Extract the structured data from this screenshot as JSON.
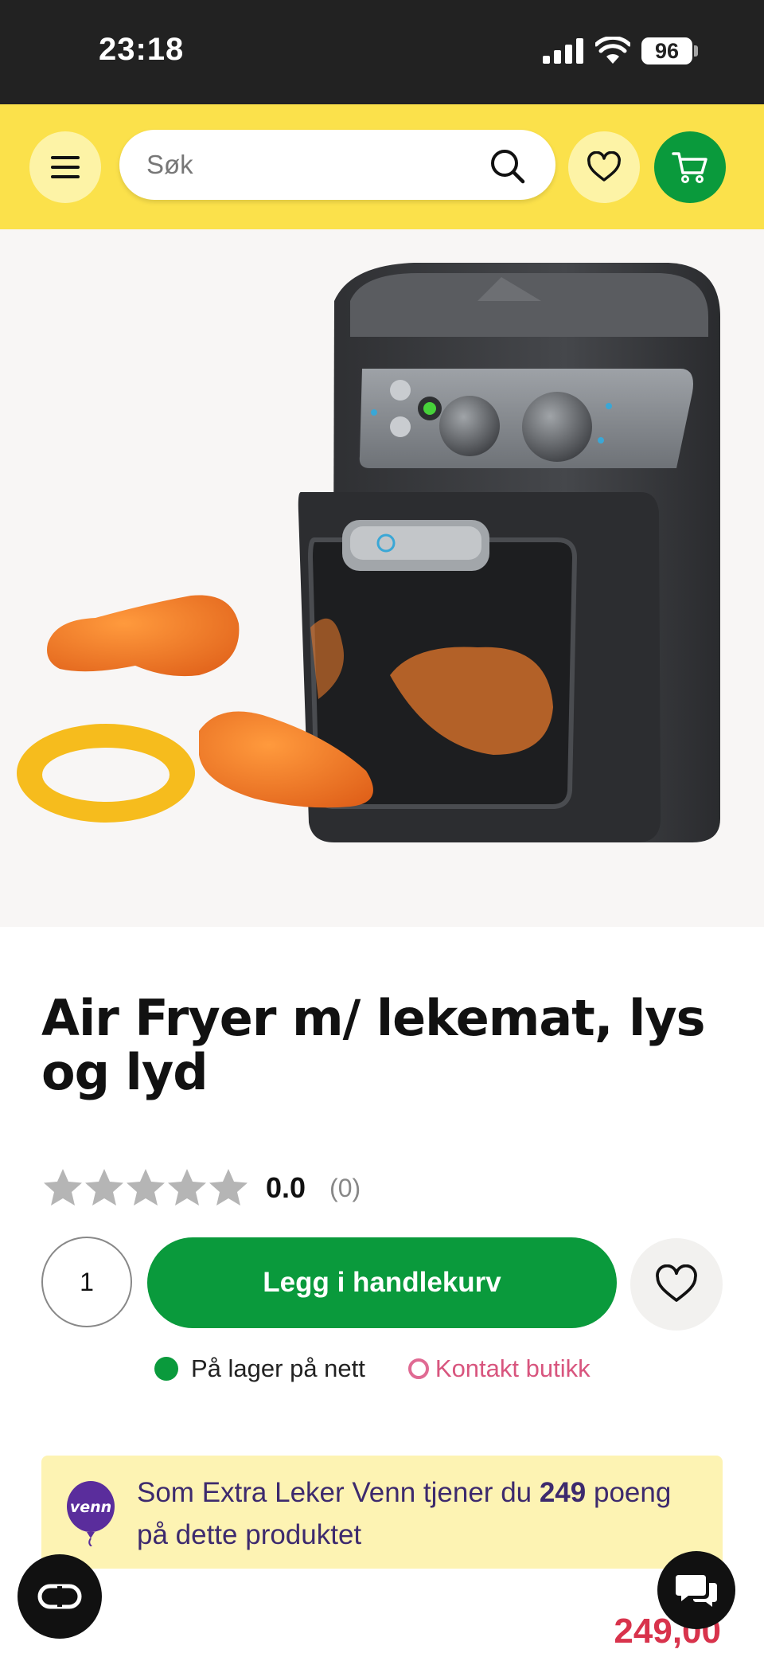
{
  "status_bar": {
    "time": "23:18",
    "battery": "96"
  },
  "header": {
    "menu_icon": "menu-icon",
    "search": {
      "placeholder": "Søk",
      "icon": "search-icon"
    },
    "wishlist_icon": "heart-icon",
    "cart_icon": "cart-icon"
  },
  "product": {
    "title": "Air Fryer m/ lekemat, lys og lyd",
    "rating": {
      "value": "0.0",
      "count": "(0)",
      "stars_filled": 0,
      "stars_total": 5
    },
    "quantity": "1",
    "add_to_cart_label": "Legg i handlekurv",
    "stock": {
      "online": "På lager på nett",
      "store_link": "Kontakt butikk"
    },
    "loyalty": {
      "logo_text": "venn",
      "text_before": "Som Extra Leker Venn tjener du ",
      "points": "249",
      "text_after": " poeng på dette produktet"
    },
    "price": "249,00"
  },
  "colors": {
    "header_bg": "#fbe14b",
    "brand_green": "#0a9a3c",
    "price_red": "#d8334c",
    "loyalty_bg": "#fdf3b3",
    "loyalty_text": "#3d2a6e"
  }
}
